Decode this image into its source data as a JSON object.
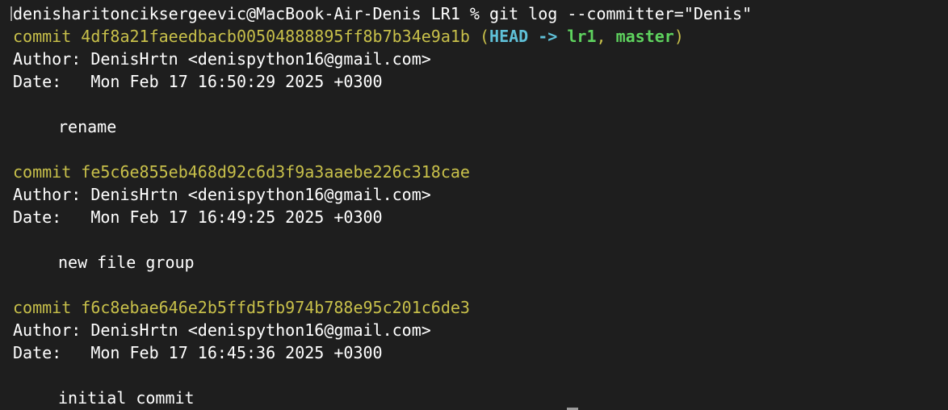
{
  "terminal": {
    "prompt_line": "denisharitonciksergeevic@MacBook-Air-Denis LR1 % git log --committer=\"Denis\""
  },
  "commits": [
    {
      "keyword": "commit",
      "hash": "4df8a21faeedbacb00504888895ff8b7b34e9a1b",
      "refs": {
        "open": " (",
        "head": "HEAD",
        "arrow": " -> ",
        "branch1": "lr1",
        "sep": ", ",
        "branch2": "master",
        "close": ")"
      },
      "author_label": "Author:",
      "author": " DenisHrtn <denispython16@gmail.com>",
      "date_label": "Date:",
      "date": "   Mon Feb 17 16:50:29 2025 +0300",
      "message": "rename"
    },
    {
      "keyword": "commit",
      "hash": "fe5c6e855eb468d92c6d3f9a3aaebe226c318cae",
      "author_label": "Author:",
      "author": " DenisHrtn <denispython16@gmail.com>",
      "date_label": "Date:",
      "date": "   Mon Feb 17 16:49:25 2025 +0300",
      "message": "new file group"
    },
    {
      "keyword": "commit",
      "hash": "f6c8ebae646e2b5ffd5fb974b788e95c201c6de3",
      "author_label": "Author:",
      "author": " DenisHrtn <denispython16@gmail.com>",
      "date_label": "Date:",
      "date": "   Mon Feb 17 16:45:36 2025 +0300",
      "message": "initial commit"
    }
  ],
  "colors": {
    "background": "#1e1e1e",
    "text": "#ffffff",
    "commit_yellow": "#c8c04a",
    "head_cyan": "#5fc0d8",
    "branch_green": "#5ed25e"
  }
}
